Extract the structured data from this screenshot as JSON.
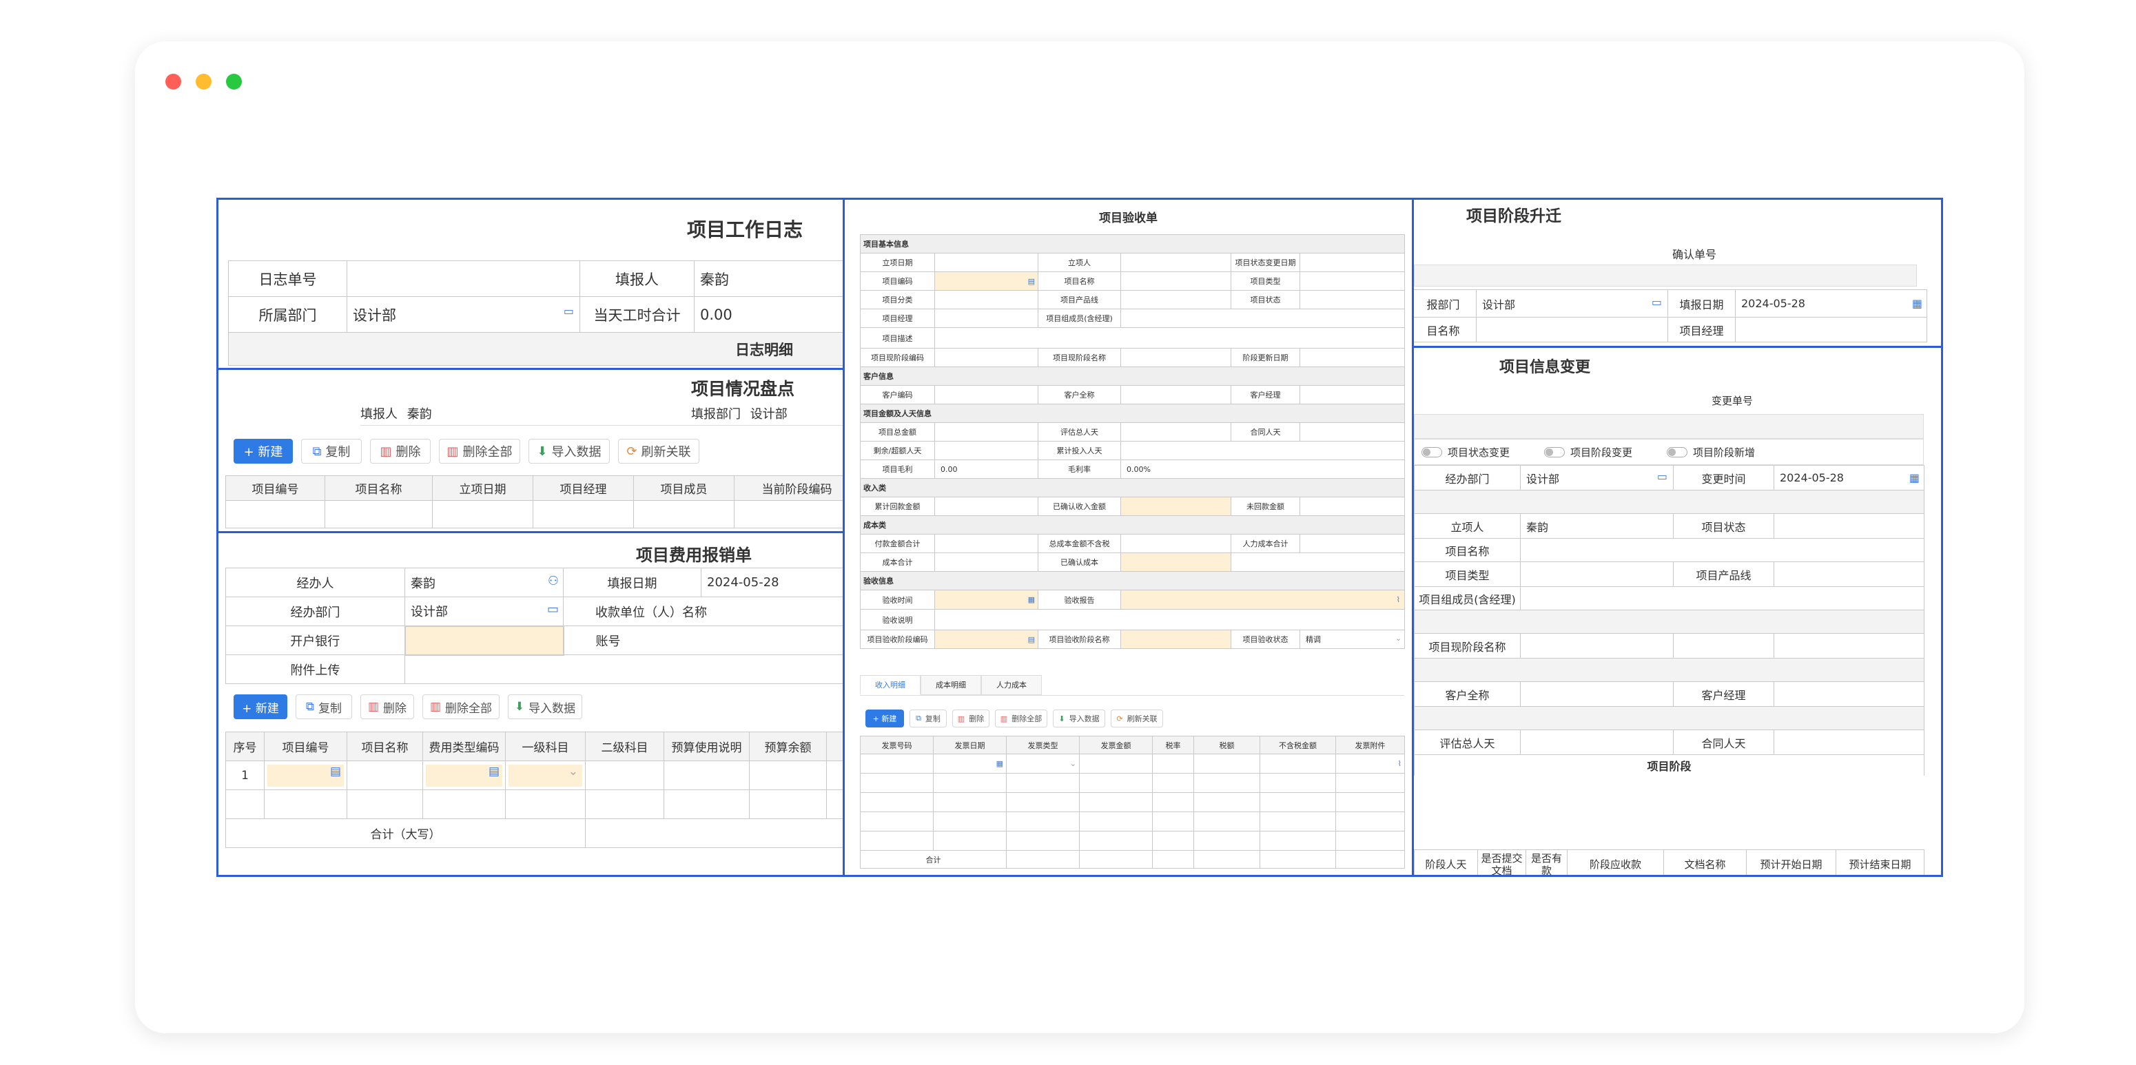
{
  "window": {
    "dots": [
      "#ff5f57",
      "#febc2e",
      "#28c840"
    ]
  },
  "log": {
    "title": "项目工作日志",
    "number_label": "日志单号",
    "reporter_label": "填报人",
    "reporter": "秦韵",
    "dept_label": "所属部门",
    "dept": "设计部",
    "hours_label": "当天工时合计",
    "hours": "0.00",
    "detail_title": "日志明细"
  },
  "inventory": {
    "title": "项目情况盘点",
    "reporter_label": "填报人",
    "reporter": "秦韵",
    "dept_label": "填报部门",
    "dept": "设计部",
    "buttons": [
      "+ 新建",
      "复制",
      "删除",
      "删除全部",
      "导入数据",
      "刷新关联"
    ],
    "columns": [
      "项目编号",
      "项目名称",
      "立项日期",
      "项目经理",
      "项目成员",
      "当前阶段编码"
    ]
  },
  "expense": {
    "title": "项目费用报销单",
    "handler_label": "经办人",
    "handler": "秦韵",
    "date_label": "填报日期",
    "date": "2024-05-28",
    "dept_label": "经办部门",
    "dept": "设计部",
    "payee_label": "收款单位（人）名称",
    "bank_label": "开户银行",
    "account_label": "账号",
    "attach_label": "附件上传",
    "buttons": [
      "+ 新建",
      "复制",
      "删除",
      "删除全部",
      "导入数据"
    ],
    "columns": [
      "序号",
      "项目编号",
      "项目名称",
      "费用类型编码",
      "一级科目",
      "二级科目",
      "预算使用说明",
      "预算余额"
    ],
    "row1_no": "1",
    "total_label": "合计（大写）"
  },
  "acceptance": {
    "title": "项目验收单",
    "sections": {
      "basic": "项目基本信息",
      "customer": "客户信息",
      "money": "项目金额及人天信息",
      "income": "收入类",
      "cost": "成本类",
      "accept": "验收信息"
    },
    "basic_rows": [
      [
        "立项日期",
        "",
        "立项人",
        "",
        "项目状态变更日期",
        ""
      ],
      [
        "项目编码",
        "",
        "项目名称",
        "",
        "项目类型",
        ""
      ],
      [
        "项目分类",
        "",
        "项目产品线",
        "",
        "项目状态",
        ""
      ],
      [
        "项目经理",
        "",
        "项目组成员(含经理)",
        "",
        "",
        ""
      ]
    ],
    "desc_label": "项目描述",
    "stage_row": [
      "项目现阶段编码",
      "",
      "项目现阶段名称",
      "",
      "阶段更新日期",
      ""
    ],
    "customer_row": [
      "客户编码",
      "",
      "客户全称",
      "",
      "客户经理",
      ""
    ],
    "money_rows": [
      [
        "项目总金额",
        "",
        "评估总人天",
        "",
        "合同人天",
        ""
      ],
      [
        "剩余/超额人天",
        "",
        "累计投入人天",
        "",
        "",
        ""
      ],
      [
        "项目毛利",
        "0.00",
        "毛利率",
        "0.00%",
        "",
        ""
      ]
    ],
    "income_row": [
      "累计回款金额",
      "",
      "已确认收入金额",
      "",
      "未回款金额",
      ""
    ],
    "cost_rows": [
      [
        "付款金额合计",
        "",
        "总成本金额不含税",
        "",
        "人力成本合计",
        ""
      ],
      [
        "成本合计",
        "",
        "已确认成本",
        "",
        "",
        ""
      ]
    ],
    "accept_time_label": "验收时间",
    "accept_report_label": "验收报告",
    "accept_note_label": "验收说明",
    "accept_stage_row": [
      "项目验收阶段编码",
      "",
      "项目验收阶段名称",
      "",
      "项目验收状态",
      "精调"
    ],
    "tabs": [
      "收入明细",
      "成本明细",
      "人力成本"
    ],
    "buttons": [
      "+ 新建",
      "复制",
      "删除",
      "删除全部",
      "导入数据",
      "刷新关联"
    ],
    "columns": [
      "发票号码",
      "发票日期",
      "发票类型",
      "发票金额",
      "税率",
      "税额",
      "不含税金额",
      "发票附件"
    ],
    "total_label": "合计"
  },
  "upgrade": {
    "title": "项目阶段升迁",
    "confirm_label": "确认单号",
    "dept_label": "报部门",
    "dept": "设计部",
    "date_label": "填报日期",
    "date": "2024-05-28",
    "name_label": "目名称",
    "manager_label": "项目经理"
  },
  "change": {
    "title": "项目信息变更",
    "change_no_label": "变更单号",
    "toggles": [
      "项目状态变更",
      "项目阶段变更",
      "项目阶段新增"
    ],
    "dept_label": "经办部门",
    "dept": "设计部",
    "time_label": "变更时间",
    "time": "2024-05-28",
    "creator_label": "立项人",
    "creator": "秦韵",
    "status_label": "项目状态",
    "name_label": "项目名称",
    "type_label": "项目类型",
    "line_label": "项目产品线",
    "members_label": "项目组成员(含经理)",
    "stage_name_label": "项目现阶段名称",
    "customer_label": "客户全称",
    "cust_mgr_label": "客户经理",
    "eval_label": "评估总人天",
    "contract_label": "合同人天",
    "stage_title": "项目阶段",
    "stage_columns": [
      "阶段人天",
      "是否提交文档",
      "是否有款",
      "阶段应收款",
      "文档名称",
      "预计开始日期",
      "预计结束日期"
    ]
  }
}
